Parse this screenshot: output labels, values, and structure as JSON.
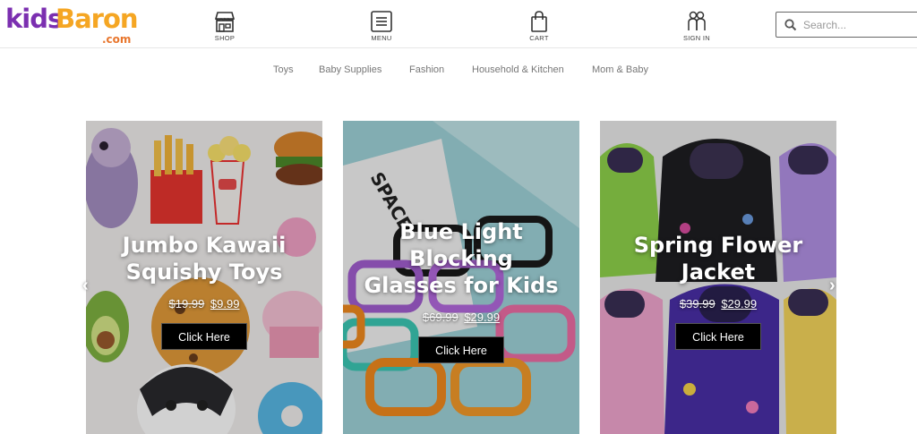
{
  "brand": {
    "kids": "kids",
    "baron": "Baron",
    "dotcom": ".com"
  },
  "nav": {
    "shop": "SHOP",
    "menu": "MENU",
    "cart": "CART",
    "signin": "SIGN IN"
  },
  "search": {
    "placeholder": "Search...",
    "value": ""
  },
  "categories": [
    "Toys",
    "Baby Supplies",
    "Fashion",
    "Household & Kitchen",
    "Mom & Baby"
  ],
  "cards": [
    {
      "title_line1": "Jumbo Kawaii",
      "title_line2": "Squishy Toys",
      "old_price": "$19.99",
      "new_price": "$9.99",
      "button": "Click Here"
    },
    {
      "title_line1": "Blue Light",
      "title_line2": "Blocking",
      "title_line3": "Glasses for Kids",
      "old_price": "$69.99",
      "new_price": "$29.99",
      "button": "Click Here"
    },
    {
      "title_line1": "Spring Flower",
      "title_line2": "Jacket",
      "old_price": "$39.99",
      "new_price": "$29.99",
      "button": "Click Here"
    }
  ],
  "arrows": {
    "prev": "‹",
    "next": "›"
  },
  "colors": {
    "brand_purple": "#7b2fb0",
    "brand_orange": "#f5a623",
    "button_bg": "#000000"
  }
}
